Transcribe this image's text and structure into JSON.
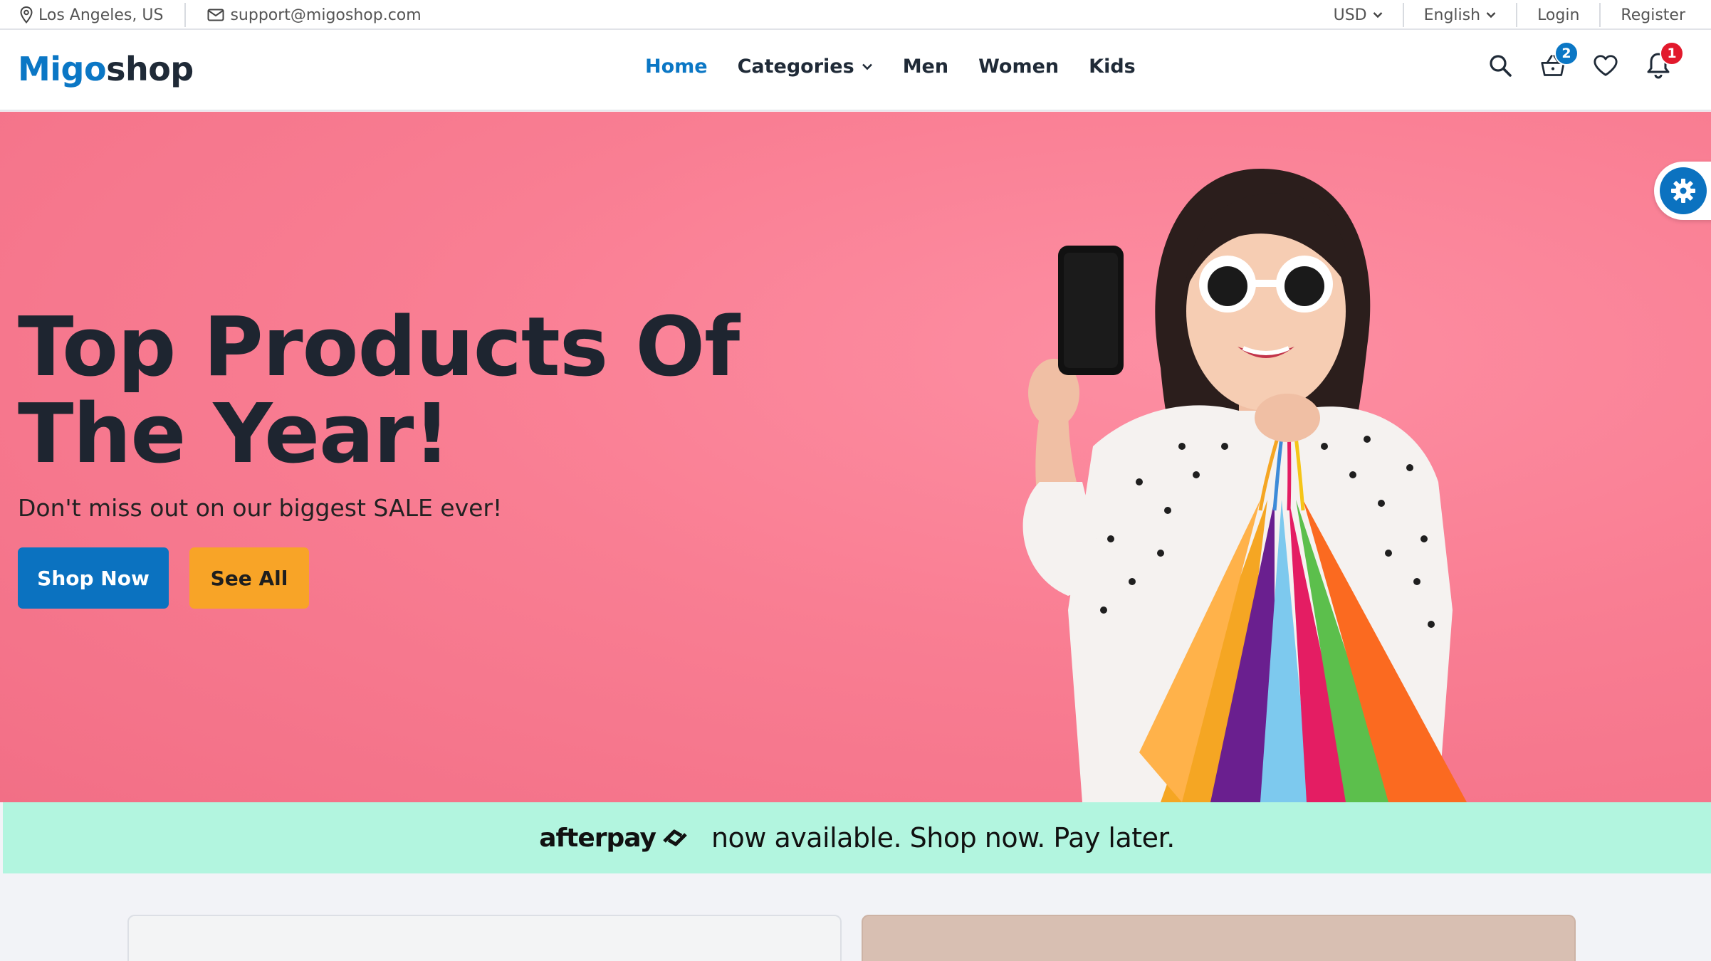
{
  "topbar": {
    "location": "Los Angeles, US",
    "email": "support@migoshop.com",
    "currency": "USD",
    "language": "English",
    "login": "Login",
    "register": "Register"
  },
  "header": {
    "logo_part1": "Migo",
    "logo_part2": "shop",
    "nav": {
      "home": "Home",
      "categories": "Categories",
      "men": "Men",
      "women": "Women",
      "kids": "Kids"
    },
    "cart_count": "2",
    "notification_count": "1"
  },
  "hero": {
    "title_line1": "Top Products Of",
    "title_line2": "The Year!",
    "subtitle": "Don't miss out on our biggest SALE ever!",
    "primary_button": "Shop Now",
    "secondary_button": "See All"
  },
  "afterpay": {
    "brand": "afterpay",
    "message": "now available. Shop now. Pay later."
  },
  "colors": {
    "brand_blue": "#0b77c5",
    "accent_orange": "#f8a427",
    "hero_pink": "#f97e93",
    "afterpay_mint": "#b2f5df",
    "badge_red": "#e2192c"
  },
  "icons": [
    "location-pin-icon",
    "mail-icon",
    "chevron-down-icon",
    "search-icon",
    "basket-icon",
    "heart-icon",
    "bell-icon",
    "gear-icon",
    "afterpay-logo-icon"
  ]
}
